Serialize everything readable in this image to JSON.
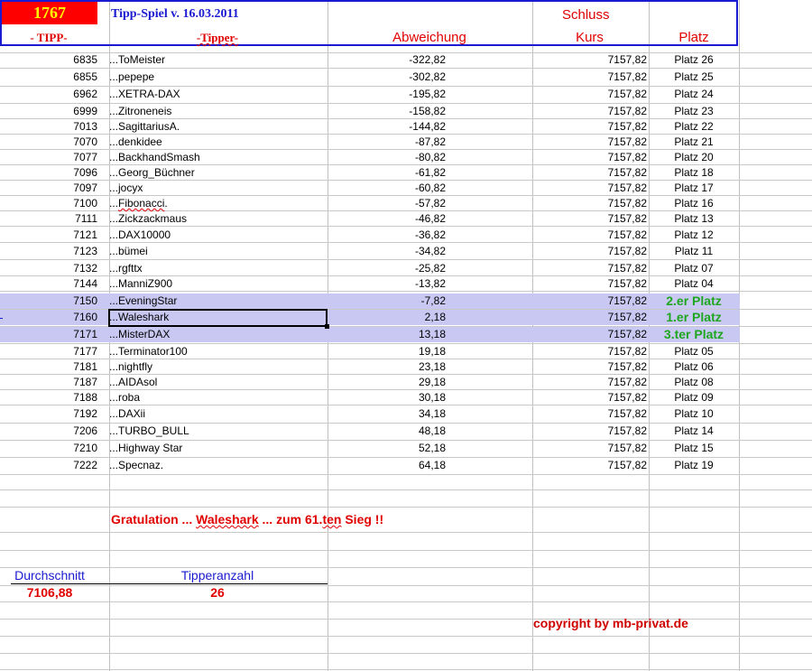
{
  "header": {
    "count": "1767",
    "title": "Tipp-Spiel v. 16.03.2011",
    "schluss": "Schluss",
    "col_tipp": "- TIPP-",
    "col_tipper": "-Tipper-",
    "col_abweichung": "Abweichung",
    "col_kurs": "Kurs",
    "col_platz": "Platz"
  },
  "rows": [
    {
      "tipp": "6835",
      "name": "...ToMeister",
      "dev": "-322,82",
      "kurs": "7157,82",
      "platz": "Platz 26"
    },
    {
      "tipp": "6855",
      "name": "...pepepe",
      "dev": "-302,82",
      "kurs": "7157,82",
      "platz": "Platz 25"
    },
    {
      "tipp": "6962",
      "name": "...XETRA-DAX",
      "dev": "-195,82",
      "kurs": "7157,82",
      "platz": "Platz 24"
    },
    {
      "tipp": "6999",
      "name": "...Zitroneneis",
      "dev": "-158,82",
      "kurs": "7157,82",
      "platz": "Platz 23"
    },
    {
      "tipp": "7013",
      "name": "...SagittariusA.",
      "dev": "-144,82",
      "kurs": "7157,82",
      "platz": "Platz 22"
    },
    {
      "tipp": "7070",
      "name": "...denkidee",
      "dev": "-87,82",
      "kurs": "7157,82",
      "platz": "Platz 21"
    },
    {
      "tipp": "7077",
      "name": "...BackhandSmash",
      "dev": "-80,82",
      "kurs": "7157,82",
      "platz": "Platz 20"
    },
    {
      "tipp": "7096",
      "name": "...Georg_Büchner",
      "dev": "-61,82",
      "kurs": "7157,82",
      "platz": "Platz 18"
    },
    {
      "tipp": "7097",
      "name": "...jocyx",
      "dev": "-60,82",
      "kurs": "7157,82",
      "platz": "Platz 17"
    },
    {
      "tipp": "7100",
      "name": "...Fibonacci.",
      "dev": "-57,82",
      "kurs": "7157,82",
      "platz": "Platz 16"
    },
    {
      "tipp": "7111",
      "name": "...Zickzackmaus",
      "dev": "-46,82",
      "kurs": "7157,82",
      "platz": "Platz 13"
    },
    {
      "tipp": "7121",
      "name": "...DAX10000",
      "dev": "-36,82",
      "kurs": "7157,82",
      "platz": "Platz 12"
    },
    {
      "tipp": "7123",
      "name": "...bümei",
      "dev": "-34,82",
      "kurs": "7157,82",
      "platz": "Platz 11"
    },
    {
      "tipp": "7132",
      "name": "...rgfttx",
      "dev": "-25,82",
      "kurs": "7157,82",
      "platz": "Platz 07"
    },
    {
      "tipp": "7144",
      "name": "...ManniZ900",
      "dev": "-13,82",
      "kurs": "7157,82",
      "platz": "Platz 04"
    },
    {
      "tipp": "7150",
      "name": "...EveningStar",
      "dev": "-7,82",
      "kurs": "7157,82",
      "platz": "2.er Platz"
    },
    {
      "tipp": "7160",
      "name": "...Waleshark",
      "dev": "2,18",
      "kurs": "7157,82",
      "platz": "1.er Platz"
    },
    {
      "tipp": "7171",
      "name": "...MisterDAX",
      "dev": "13,18",
      "kurs": "7157,82",
      "platz": "3.ter Platz"
    },
    {
      "tipp": "7177",
      "name": "...Terminator100",
      "dev": "19,18",
      "kurs": "7157,82",
      "platz": "Platz 05"
    },
    {
      "tipp": "7181",
      "name": "...nightfly",
      "dev": "23,18",
      "kurs": "7157,82",
      "platz": "Platz 06"
    },
    {
      "tipp": "7187",
      "name": "...AIDAsol",
      "dev": "29,18",
      "kurs": "7157,82",
      "platz": "Platz 08"
    },
    {
      "tipp": "7188",
      "name": "...roba",
      "dev": "30,18",
      "kurs": "7157,82",
      "platz": "Platz 09"
    },
    {
      "tipp": "7192",
      "name": "...DAXii",
      "dev": "34,18",
      "kurs": "7157,82",
      "platz": "Platz 10"
    },
    {
      "tipp": "7206",
      "name": "...TURBO_BULL",
      "dev": "48,18",
      "kurs": "7157,82",
      "platz": "Platz 14"
    },
    {
      "tipp": "7210",
      "name": "...Highway Star",
      "dev": "52,18",
      "kurs": "7157,82",
      "platz": "Platz 15"
    },
    {
      "tipp": "7222",
      "name": "...Specnaz.",
      "dev": "64,18",
      "kurs": "7157,82",
      "platz": "Platz 19"
    }
  ],
  "congrats": {
    "part1": "Gratulation ... ",
    "winner": "Waleshark",
    "part2": " ...  zum   61.",
    "ten": "ten",
    "part3": " Sieg !!"
  },
  "stats": {
    "avg_label": "Durchschnitt",
    "avg_value": "7106,88",
    "count_label": "Tipperanzahl",
    "count_value": "26"
  },
  "copyright": "copyright by mb-privat.de",
  "colors": {
    "header_border": "#1a1ad0",
    "count_bg": "#ff0000",
    "count_text": "#ffff00",
    "highlight_row": "#c8c8f2",
    "winner_text": "#1fa61f",
    "red_text": "#e00000"
  }
}
